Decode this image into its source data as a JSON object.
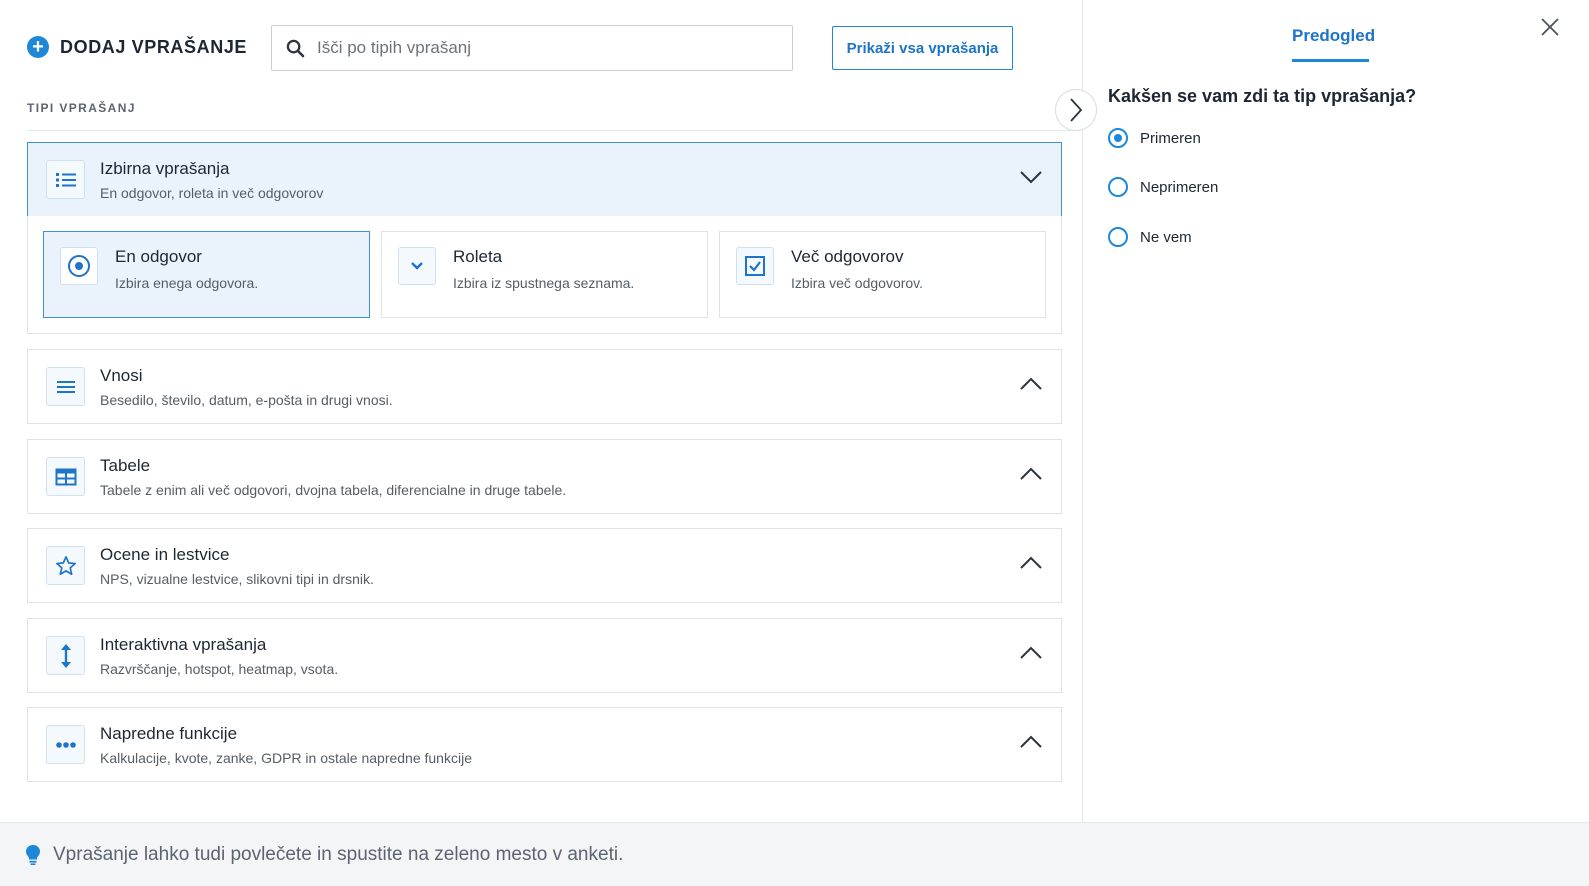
{
  "header": {
    "add_title": "DODAJ VPRAŠANJE",
    "search_placeholder": "Išči po tipih vprašanj",
    "show_all_label": "Prikaži vsa vprašanja"
  },
  "section_label": "TIPI VPRAŠANJ",
  "categories": [
    {
      "title": "Izbirna vprašanja",
      "desc": "En odgovor, roleta in več odgovorov",
      "icon": "list-icon",
      "expanded": true
    },
    {
      "title": "Vnosi",
      "desc": "Besedilo, število, datum, e-pošta in drugi vnosi.",
      "icon": "text-lines-icon",
      "expanded": false
    },
    {
      "title": "Tabele",
      "desc": "Tabele z enim ali več odgovori, dvojna tabela, diferencialne in druge tabele.",
      "icon": "table-icon",
      "expanded": false
    },
    {
      "title": "Ocene in lestvice",
      "desc": "NPS, vizualne lestvice, slikovni tipi in drsnik.",
      "icon": "star-icon",
      "expanded": false
    },
    {
      "title": "Interaktivna vprašanja",
      "desc": "Razvrščanje, hotspot, heatmap, vsota.",
      "icon": "vertical-arrows-icon",
      "expanded": false
    },
    {
      "title": "Napredne funkcije",
      "desc": "Kalkulacije, kvote, zanke, GDPR in ostale napredne funkcije",
      "icon": "more-dots-icon",
      "expanded": false
    }
  ],
  "choice_options": [
    {
      "title": "En odgovor",
      "desc": "Izbira enega odgovora.",
      "icon": "radio-icon",
      "selected": true
    },
    {
      "title": "Roleta",
      "desc": "Izbira iz spustnega seznama.",
      "icon": "dropdown-icon",
      "selected": false
    },
    {
      "title": "Več odgovorov",
      "desc": "Izbira več odgovorov.",
      "icon": "checkbox-icon",
      "selected": false
    }
  ],
  "preview": {
    "tab_label": "Predogled",
    "question": "Kakšen se vam zdi ta tip vprašanja?",
    "answers": [
      {
        "label": "Primeren",
        "checked": true
      },
      {
        "label": "Neprimeren",
        "checked": false
      },
      {
        "label": "Ne vem",
        "checked": false
      }
    ]
  },
  "footer": {
    "hint": "Vprašanje lahko tudi povlečete in spustite na zeleno mesto v anketi."
  },
  "colors": {
    "accent": "#1e88d8",
    "active_bg": "#eaf3fc",
    "border": "#dfe3e7"
  }
}
